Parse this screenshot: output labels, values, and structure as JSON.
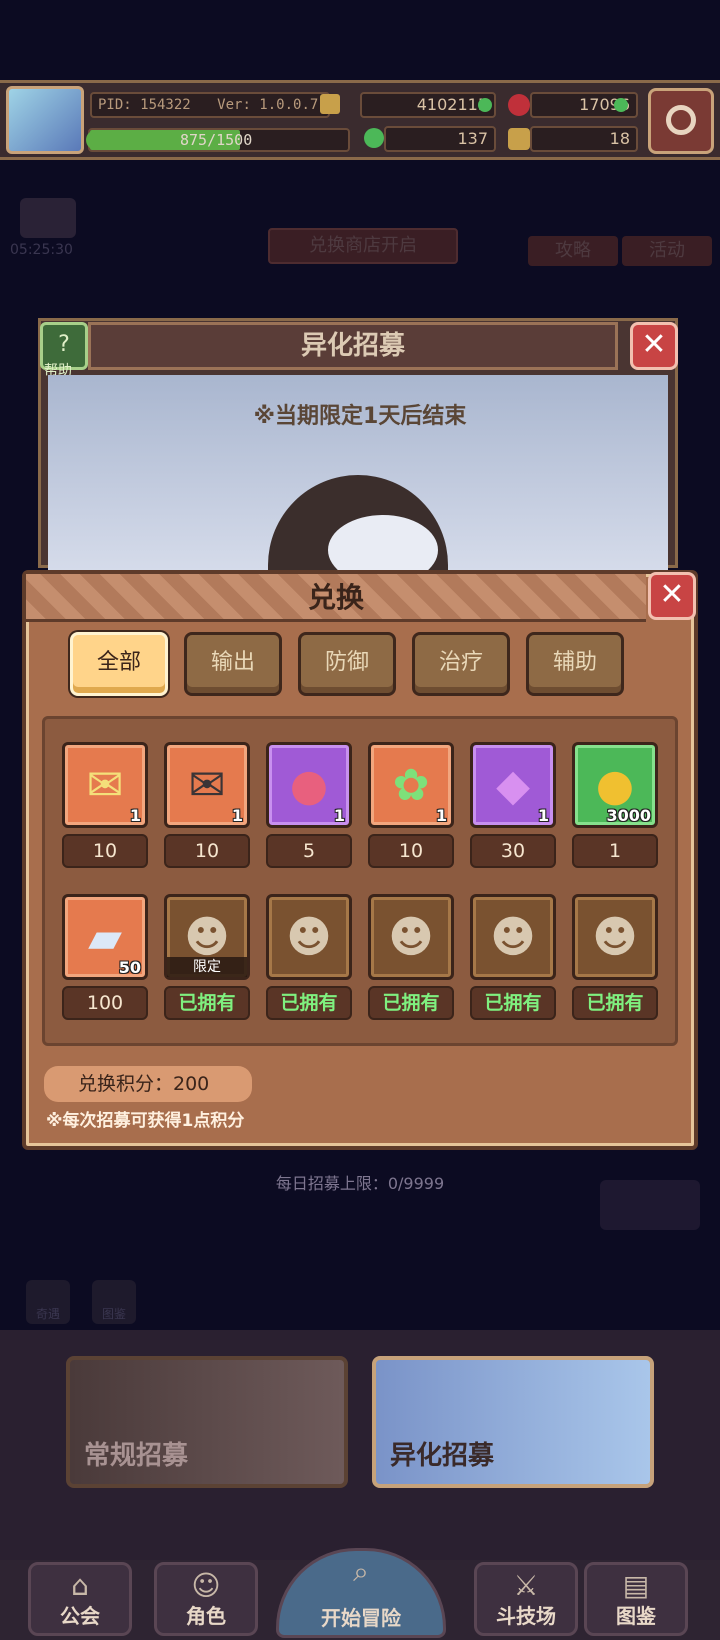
{
  "header": {
    "pid": "PID: 154322",
    "version": "Ver: 1.0.0.7",
    "stamina": "875/1500",
    "stamina_fraction": 0.583,
    "gold": "4102115",
    "gems": "17096",
    "clovers": "137",
    "keys": "18"
  },
  "bg": {
    "countdown": "05:25:30",
    "exchange_open": "兑换商店开启",
    "guide_label": "攻略",
    "event_label": "活动",
    "recruit_title": "异化招募",
    "help_label": "帮助",
    "limited_notice": "※当期限定1天后结束",
    "daily_limit": "每日招募上限：0/9999",
    "mini1": "奇遇",
    "mini2": "图鉴"
  },
  "exchange": {
    "title": "兑换",
    "tabs": [
      {
        "label": "全部",
        "active": true
      },
      {
        "label": "输出",
        "active": false
      },
      {
        "label": "防御",
        "active": false
      },
      {
        "label": "治疗",
        "active": false
      },
      {
        "label": "辅助",
        "active": false
      }
    ],
    "items": [
      {
        "icon": "yellow-letter-icon",
        "qty": "1",
        "price": "10",
        "bg": "orange"
      },
      {
        "icon": "dark-letter-icon",
        "qty": "1",
        "price": "10",
        "bg": "orange"
      },
      {
        "icon": "pink-fruit-icon",
        "qty": "1",
        "price": "5",
        "bg": "purple"
      },
      {
        "icon": "clover-icon",
        "qty": "1",
        "price": "10",
        "bg": "orange"
      },
      {
        "icon": "purple-crystal-icon",
        "qty": "1",
        "price": "30",
        "bg": "purple"
      },
      {
        "icon": "gold-coin-icon",
        "qty": "3000",
        "price": "1",
        "bg": "green"
      },
      {
        "icon": "puzzle-piece-icon",
        "qty": "50",
        "price": "100",
        "bg": "orange"
      },
      {
        "icon": "hero-portrait-icon",
        "tag": "限定",
        "price": "已拥有",
        "bg": "brown"
      },
      {
        "icon": "hero-portrait-icon",
        "price": "已拥有",
        "bg": "brown"
      },
      {
        "icon": "hero-portrait-icon",
        "price": "已拥有",
        "bg": "brown"
      },
      {
        "icon": "hero-portrait-icon",
        "price": "已拥有",
        "bg": "brown"
      },
      {
        "icon": "hero-portrait-icon",
        "price": "已拥有",
        "bg": "brown"
      }
    ],
    "points_label": "兑换积分：200",
    "note": "※每次招募可获得1点积分"
  },
  "banners": {
    "normal": "常规招募",
    "special": "异化招募"
  },
  "nav": [
    {
      "label": "公会",
      "icon": "shop-icon"
    },
    {
      "label": "角色",
      "icon": "character-icon"
    },
    {
      "label": "开始冒险",
      "icon": "magnifier-icon"
    },
    {
      "label": "斗技场",
      "icon": "crossed-swords-icon"
    },
    {
      "label": "图鉴",
      "icon": "book-icon"
    }
  ],
  "colors": {
    "accent_orange": "#e57a4e",
    "accent_purple": "#a05ad6",
    "accent_green": "#4cb858",
    "owned_text": "#7ff07f",
    "close_red": "#c84444"
  }
}
